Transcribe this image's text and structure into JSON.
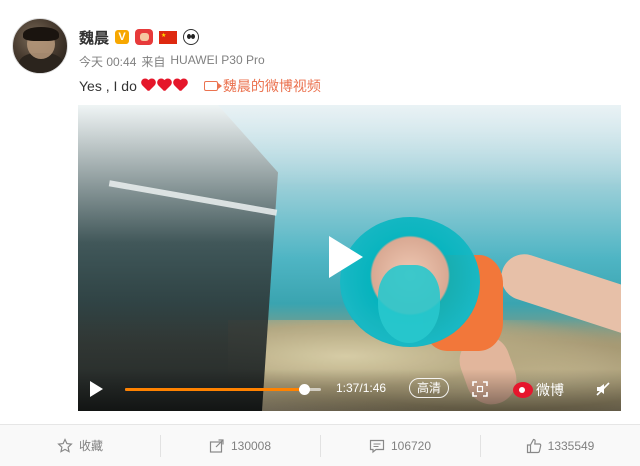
{
  "post": {
    "username": "魏晨",
    "verified_badge": "V",
    "time": "今天 00:44",
    "source_prefix": "来自",
    "source": "HUAWEI P30 Pro",
    "text": "Yes , I do",
    "hearts": 3,
    "video_link": "魏晨的微博视频"
  },
  "video": {
    "current_time": "1:37",
    "separator": "/",
    "duration": "1:46",
    "progress": 0.915,
    "quality": "高清",
    "watermark": "微博"
  },
  "footer": {
    "favorite_label": "收藏",
    "repost_count": "130008",
    "comment_count": "106720",
    "like_count": "1335549"
  },
  "colors": {
    "accent": "#eb7350",
    "progress": "#ff8200",
    "heart": "#e5162a",
    "weibo_red": "#e6162d"
  }
}
